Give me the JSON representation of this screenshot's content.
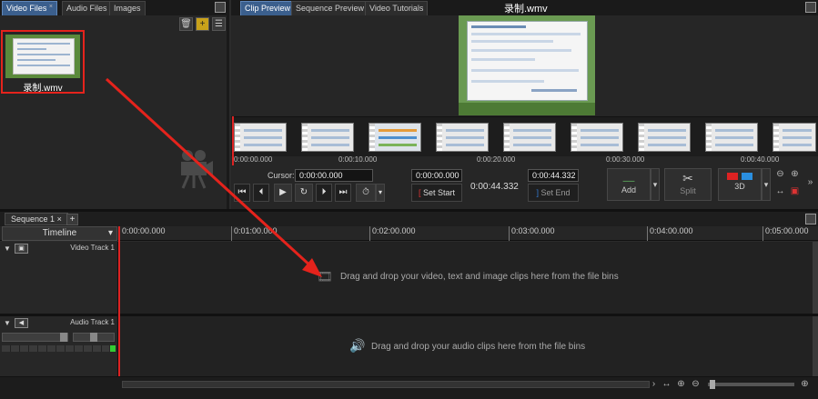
{
  "bins": {
    "tabs": [
      "Video Files",
      "Audio Files",
      "Images"
    ],
    "active_tab_close": "×",
    "clip": {
      "name": "录制.wmv"
    }
  },
  "preview": {
    "tabs": [
      "Clip Preview",
      "Sequence Preview",
      "Video Tutorials"
    ],
    "title": "录制.wmv",
    "strip_times": [
      "0:00:00.000",
      "0:00:10.000",
      "0:00:20.000",
      "0:00:30.000",
      "0:00:40.000"
    ],
    "cursor_label": "Cursor:",
    "cursor_value": "0:00:00.000",
    "in_value": "0:00:00.000",
    "duration": "0:00:44.332",
    "out_value": "0:00:44.332",
    "set_start": "Set Start",
    "set_end": "Set End",
    "add": "Add",
    "split": "Split",
    "three_d": "3D"
  },
  "sequence": {
    "tab": "Sequence 1",
    "tab_close": "×",
    "add_tab": "+",
    "timeline_label": "Timeline",
    "ruler_ticks": [
      "0:00:00.000",
      "0:01:00.000",
      "0:02:00.000",
      "0:03:00.000",
      "0:04:00.000",
      "0:05:00.000"
    ],
    "video_track_name": "Video Track 1",
    "video_hint": "Drag and drop your video, text and image clips here from the file bins",
    "audio_track_name": "Audio Track 1",
    "audio_hint": "Drag and drop your audio clips here from the file bins"
  },
  "colors": {
    "annotation": "#e5231c",
    "active_tab": "#3b5f8d",
    "playhead": "#dd2222"
  }
}
